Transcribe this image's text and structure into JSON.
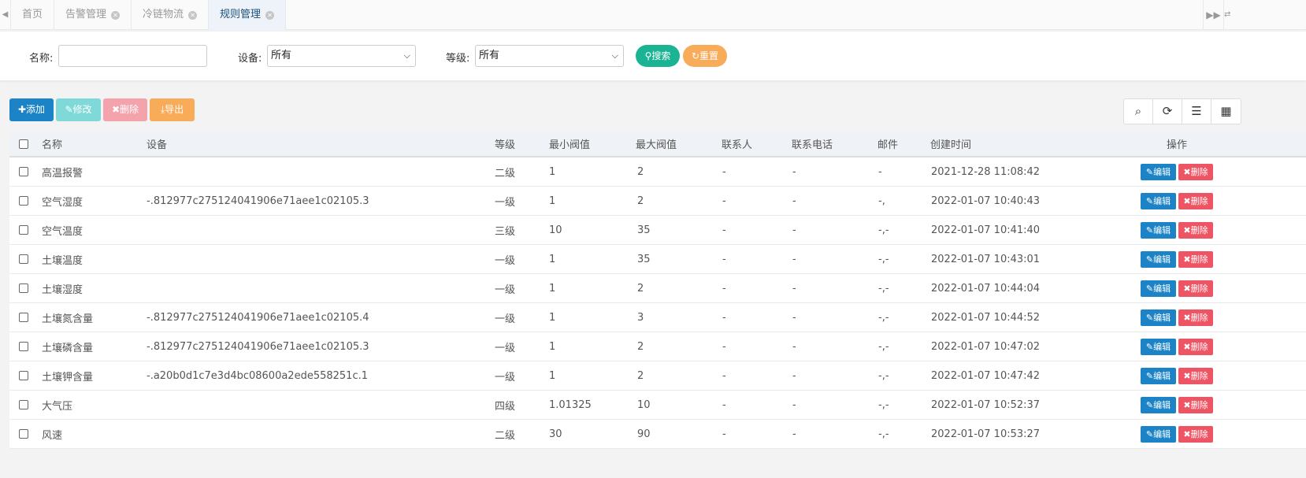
{
  "tabs": [
    {
      "label": "首页",
      "closable": false,
      "active": false
    },
    {
      "label": "告警管理",
      "closable": true,
      "active": false
    },
    {
      "label": "冷链物流",
      "closable": true,
      "active": false
    },
    {
      "label": "规则管理",
      "closable": true,
      "active": true
    }
  ],
  "search": {
    "name_label": "名称:",
    "name_value": "",
    "device_label": "设备:",
    "device_value": "所有",
    "level_label": "等级:",
    "level_value": "所有",
    "search_button": "搜索",
    "reset_button": "重置"
  },
  "toolbar": {
    "add": "添加",
    "edit": "修改",
    "delete": "删除",
    "export": "导出"
  },
  "table": {
    "headers": {
      "name": "名称",
      "device": "设备",
      "level": "等级",
      "min": "最小阀值",
      "max": "最大阀值",
      "contact": "联系人",
      "phone": "联系电话",
      "email": "邮件",
      "created": "创建时间",
      "ops": "操作"
    },
    "edit_label": "编辑",
    "delete_label": "删除",
    "rows": [
      {
        "name": "高温报警",
        "device": "",
        "level": "二级",
        "min": "1",
        "max": "2",
        "contact": "-",
        "phone": "-",
        "email": "-",
        "created": "2021-12-28 11:08:42"
      },
      {
        "name": "空气湿度",
        "device": "-.812977c275124041906e71aee1c02105.3",
        "level": "一级",
        "min": "1",
        "max": "2",
        "contact": "-",
        "phone": "-",
        "email": "-,",
        "created": "2022-01-07 10:40:43"
      },
      {
        "name": "空气温度",
        "device": "",
        "level": "三级",
        "min": "10",
        "max": "35",
        "contact": "-",
        "phone": "-",
        "email": "-,-",
        "created": "2022-01-07 10:41:40"
      },
      {
        "name": "土壤温度",
        "device": "",
        "level": "一级",
        "min": "1",
        "max": "35",
        "contact": "-",
        "phone": "-",
        "email": "-,-",
        "created": "2022-01-07 10:43:01"
      },
      {
        "name": "土壤湿度",
        "device": "",
        "level": "一级",
        "min": "1",
        "max": "2",
        "contact": "-",
        "phone": "-",
        "email": "-,-",
        "created": "2022-01-07 10:44:04"
      },
      {
        "name": "土壤氮含量",
        "device": "-.812977c275124041906e71aee1c02105.4",
        "level": "一级",
        "min": "1",
        "max": "3",
        "contact": "-",
        "phone": "-",
        "email": "-,-",
        "created": "2022-01-07 10:44:52"
      },
      {
        "name": "土壤磷含量",
        "device": "-.812977c275124041906e71aee1c02105.3",
        "level": "一级",
        "min": "1",
        "max": "2",
        "contact": "-",
        "phone": "-",
        "email": "-,-",
        "created": "2022-01-07 10:47:02"
      },
      {
        "name": "土壤钾含量",
        "device": "-.a20b0d1c7e3d4bc08600a2ede558251c.1",
        "level": "一级",
        "min": "1",
        "max": "2",
        "contact": "-",
        "phone": "-",
        "email": "-,-",
        "created": "2022-01-07 10:47:42"
      },
      {
        "name": "大气压",
        "device": "",
        "level": "四级",
        "min": "1.01325",
        "max": "10",
        "contact": "-",
        "phone": "-",
        "email": "-,-",
        "created": "2022-01-07 10:52:37"
      },
      {
        "name": "风速",
        "device": "",
        "level": "二级",
        "min": "30",
        "max": "90",
        "contact": "-",
        "phone": "-",
        "email": "-,-",
        "created": "2022-01-07 10:53:27"
      }
    ]
  },
  "colors": {
    "primary": "#1c84c6",
    "info": "#23c6c8",
    "danger": "#ed5565",
    "warning": "#f8ac59",
    "success": "#1ab394"
  }
}
